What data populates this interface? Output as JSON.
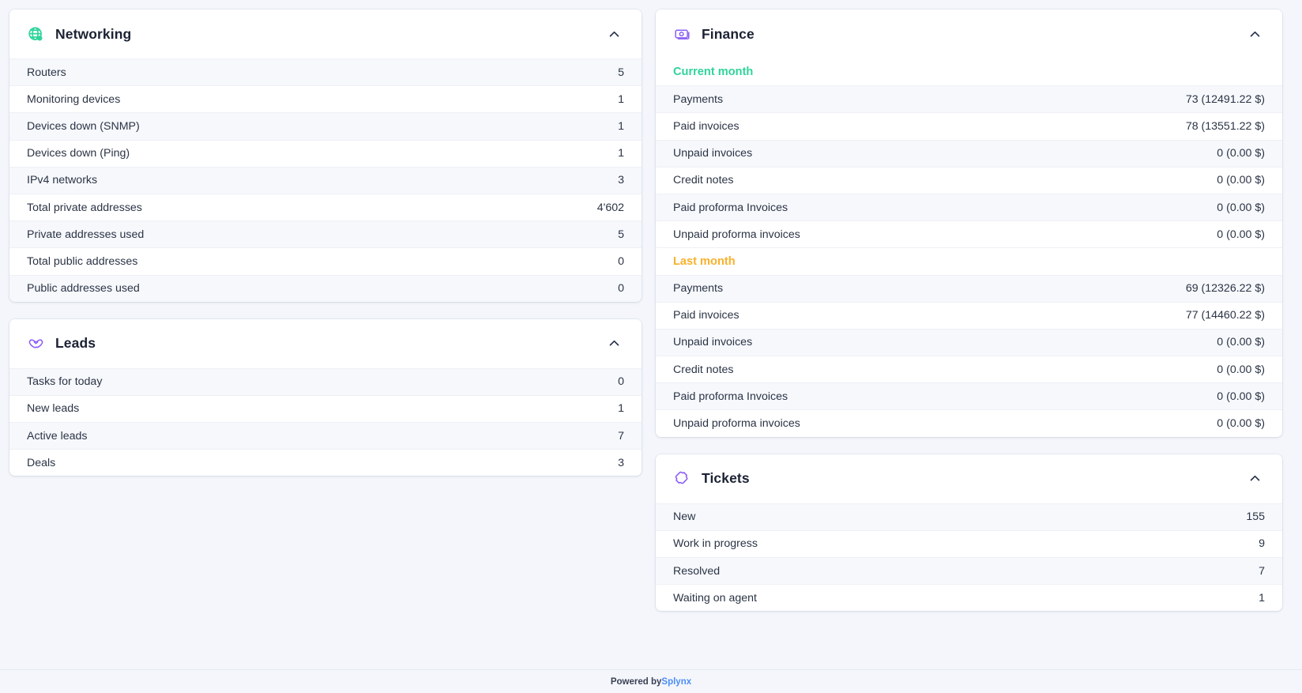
{
  "cards": {
    "networking": {
      "title": "Networking",
      "icon": "globe-icon",
      "icon_color": "#2fd49a",
      "collapse_icon": "chevron-up-icon",
      "rows": [
        {
          "label": "Routers",
          "value": "5"
        },
        {
          "label": "Monitoring devices",
          "value": "1"
        },
        {
          "label": "Devices down (SNMP)",
          "value": "1"
        },
        {
          "label": "Devices down (Ping)",
          "value": "1"
        },
        {
          "label": "IPv4 networks",
          "value": "3"
        },
        {
          "label": "Total private addresses",
          "value": "4'602"
        },
        {
          "label": "Private addresses used",
          "value": "5"
        },
        {
          "label": "Total public addresses",
          "value": "0"
        },
        {
          "label": "Public addresses used",
          "value": "0"
        }
      ]
    },
    "leads": {
      "title": "Leads",
      "icon": "handshake-icon",
      "icon_color": "#8b5cf6",
      "collapse_icon": "chevron-up-icon",
      "rows": [
        {
          "label": "Tasks for today",
          "value": "0"
        },
        {
          "label": "New leads",
          "value": "1"
        },
        {
          "label": "Active leads",
          "value": "7"
        },
        {
          "label": "Deals",
          "value": "3"
        }
      ]
    },
    "finance": {
      "title": "Finance",
      "icon": "banknote-icon",
      "icon_color": "#8b5cf6",
      "collapse_icon": "chevron-up-icon",
      "sections": [
        {
          "heading": "Current month",
          "heading_color": "#2fd49a",
          "rows": [
            {
              "label": "Payments",
              "value": "73 (12491.22 $)"
            },
            {
              "label": "Paid invoices",
              "value": "78 (13551.22 $)"
            },
            {
              "label": "Unpaid invoices",
              "value": "0 (0.00 $)"
            },
            {
              "label": "Credit notes",
              "value": "0 (0.00 $)"
            },
            {
              "label": "Paid proforma Invoices",
              "value": "0 (0.00 $)"
            },
            {
              "label": "Unpaid proforma invoices",
              "value": "0 (0.00 $)"
            }
          ]
        },
        {
          "heading": "Last month",
          "heading_color": "#f8b12c",
          "rows": [
            {
              "label": "Payments",
              "value": "69 (12326.22 $)"
            },
            {
              "label": "Paid invoices",
              "value": "77 (14460.22 $)"
            },
            {
              "label": "Unpaid invoices",
              "value": "0 (0.00 $)"
            },
            {
              "label": "Credit notes",
              "value": "0 (0.00 $)"
            },
            {
              "label": "Paid proforma Invoices",
              "value": "0 (0.00 $)"
            },
            {
              "label": "Unpaid proforma invoices",
              "value": "0 (0.00 $)"
            }
          ]
        }
      ]
    },
    "tickets": {
      "title": "Tickets",
      "icon": "ticket-icon",
      "icon_color": "#8b5cf6",
      "collapse_icon": "chevron-up-icon",
      "rows": [
        {
          "label": "New",
          "value": "155"
        },
        {
          "label": "Work in progress",
          "value": "9"
        },
        {
          "label": "Resolved",
          "value": "7"
        },
        {
          "label": "Waiting on agent",
          "value": "1"
        }
      ]
    }
  },
  "footer": {
    "prefix": "Powered by ",
    "brand": "Splynx",
    "brand_color": "#4c8df6"
  }
}
